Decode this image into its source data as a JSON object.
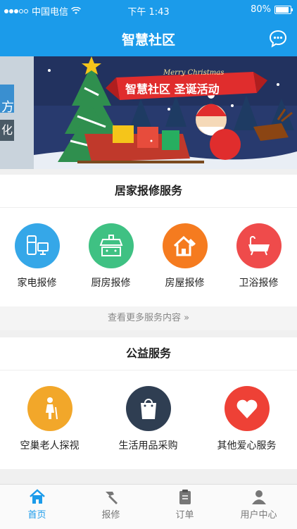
{
  "status_bar": {
    "carrier": "中国电信",
    "time": "下午 1:43",
    "battery": "80%"
  },
  "nav": {
    "title": "智慧社区",
    "chat_icon": "chat-bubble-icon"
  },
  "banner": {
    "script_text": "Merry Christmas",
    "ribbon_text": "智慧社区 圣诞活动",
    "side_chars": [
      "方",
      "化"
    ]
  },
  "home_repair": {
    "title": "居家报修服务",
    "items": [
      {
        "label": "家电报修",
        "icon": "appliance-icon",
        "color": "#35a7e8"
      },
      {
        "label": "厨房报修",
        "icon": "kitchen-hood-icon",
        "color": "#3fc183"
      },
      {
        "label": "房屋报修",
        "icon": "house-wrench-icon",
        "color": "#f57b1f"
      },
      {
        "label": "卫浴报修",
        "icon": "bathtub-icon",
        "color": "#ef4b4b"
      }
    ],
    "more": "查看更多服务内容 »"
  },
  "welfare": {
    "title": "公益服务",
    "items": [
      {
        "label": "空巢老人探视",
        "icon": "elderly-person-icon",
        "color": "#f2a72a"
      },
      {
        "label": "生活用品采购",
        "icon": "shopping-bag-icon",
        "color": "#2f3e52"
      },
      {
        "label": "其他爱心服务",
        "icon": "heart-icon",
        "color": "#ee4136"
      }
    ]
  },
  "tabs": [
    {
      "label": "首页",
      "icon": "home-icon",
      "active": true
    },
    {
      "label": "报修",
      "icon": "hammer-icon",
      "active": false
    },
    {
      "label": "订单",
      "icon": "clipboard-icon",
      "active": false
    },
    {
      "label": "用户中心",
      "icon": "user-icon",
      "active": false
    }
  ]
}
